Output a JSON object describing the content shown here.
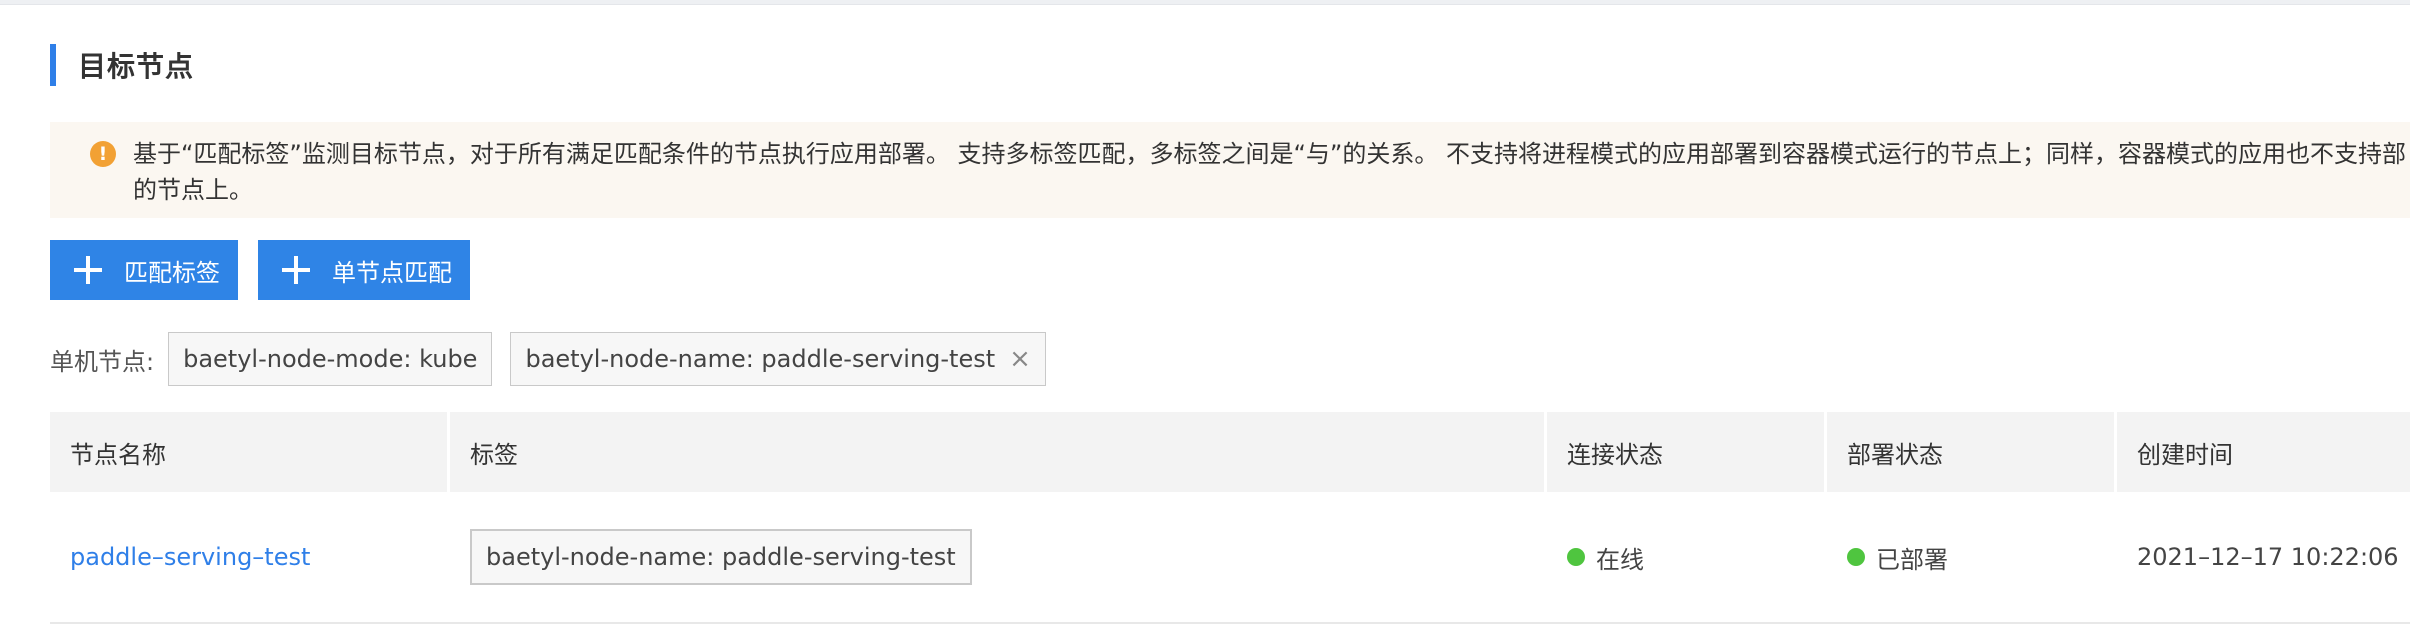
{
  "section": {
    "title": "目标节点"
  },
  "notice": {
    "icon": "warning-icon",
    "line1": "基于“匹配标签”监测目标节点，对于所有满足匹配条件的节点执行应用部署。 支持多标签匹配，多标签之间是“与”的关系。 不支持将进程模式的应用部署到容器模式运行的节点上；同样，容器模式的应用也不支持部",
    "line2": "的节点上。"
  },
  "buttons": {
    "match_label": "匹配标签",
    "single_node": "单节点匹配"
  },
  "node_filter": {
    "label": "单机节点:",
    "tags": [
      "baetyl-node-mode: kube",
      "baetyl-node-name: paddle-serving-test"
    ],
    "close_icon": "×"
  },
  "table": {
    "headers": {
      "name": "节点名称",
      "labels": "标签",
      "connection": "连接状态",
      "deploy": "部署状态",
      "created": "创建时间"
    },
    "rows": [
      {
        "name": "paddle–serving–test",
        "label": "baetyl-node-name: paddle-serving-test",
        "connection": "在线",
        "deploy": "已部署",
        "created": "2021–12–17 10:22:06"
      }
    ]
  },
  "colors": {
    "accent": "#2f84e6",
    "online": "#4fc53f",
    "warning": "#f2a134",
    "notice_bg": "#fbf7f1"
  }
}
